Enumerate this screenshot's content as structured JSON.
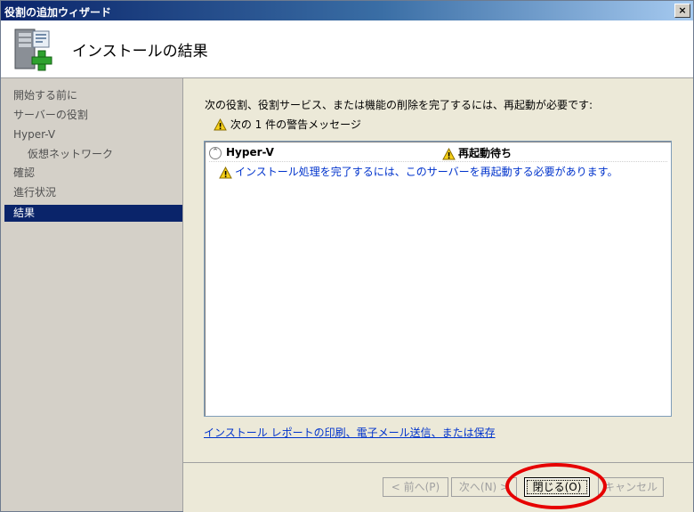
{
  "window": {
    "title": "役割の追加ウィザード",
    "close_label": "×"
  },
  "header": {
    "title": "インストールの結果",
    "icon": "server-add-icon"
  },
  "sidebar": {
    "items": [
      {
        "label": "開始する前に"
      },
      {
        "label": "サーバーの役割"
      },
      {
        "label": "Hyper-V"
      },
      {
        "label": "仮想ネットワーク"
      },
      {
        "label": "確認"
      },
      {
        "label": "進行状況"
      },
      {
        "label": "結果"
      }
    ]
  },
  "content": {
    "message": "次の役割、役割サービス、または機能の削除を完了するには、再起動が必要です:",
    "warning_summary": "次の 1 件の警告メッセージ",
    "results": {
      "role": "Hyper-V",
      "status": "再起動待ち",
      "detail": "インストール処理を完了するには、このサーバーを再起動する必要があります。"
    },
    "report_link": "インストール レポートの印刷、電子メール送信、または保存"
  },
  "buttons": {
    "prev": "< 前へ(P)",
    "next": "次へ(N) >",
    "close": "閉じる(O)",
    "cancel": "キャンセル"
  },
  "colors": {
    "highlight": "#e60000",
    "selection": "#0a246a",
    "link": "#0033cc"
  }
}
